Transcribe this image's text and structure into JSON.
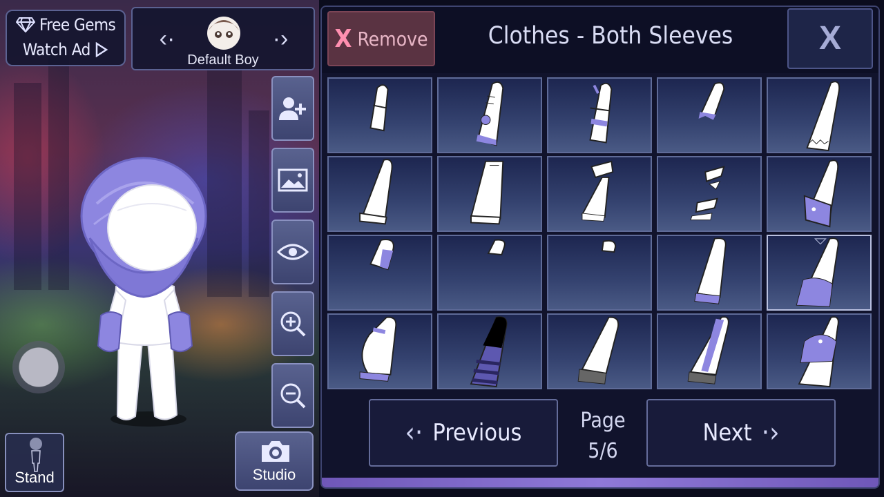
{
  "top_left": {
    "gems_label": "Free Gems",
    "watch_ad_label": "Watch Ad",
    "character_name": "Default Boy"
  },
  "side_buttons": [
    "add-character-icon",
    "background-icon",
    "eye-icon",
    "zoom-in-icon",
    "zoom-out-icon"
  ],
  "stand_label": "Stand",
  "studio_label": "Studio",
  "panel": {
    "remove_label": "Remove",
    "remove_x": "X",
    "title": "Clothes - Both Sleeves",
    "close_label": "X",
    "previous_label": "Previous",
    "next_label": "Next",
    "page_word": "Page",
    "page_number": "5/6"
  },
  "items": [
    {
      "row": 1,
      "col": 1,
      "selected": false
    },
    {
      "row": 1,
      "col": 2,
      "selected": false
    },
    {
      "row": 1,
      "col": 3,
      "selected": false
    },
    {
      "row": 1,
      "col": 4,
      "selected": false
    },
    {
      "row": 1,
      "col": 5,
      "selected": false
    },
    {
      "row": 2,
      "col": 1,
      "selected": false
    },
    {
      "row": 2,
      "col": 2,
      "selected": false
    },
    {
      "row": 2,
      "col": 3,
      "selected": false
    },
    {
      "row": 2,
      "col": 4,
      "selected": false
    },
    {
      "row": 2,
      "col": 5,
      "selected": false
    },
    {
      "row": 3,
      "col": 1,
      "selected": false
    },
    {
      "row": 3,
      "col": 2,
      "selected": false
    },
    {
      "row": 3,
      "col": 3,
      "selected": false
    },
    {
      "row": 3,
      "col": 4,
      "selected": false
    },
    {
      "row": 3,
      "col": 5,
      "selected": true
    },
    {
      "row": 4,
      "col": 1,
      "selected": false
    },
    {
      "row": 4,
      "col": 2,
      "selected": false
    },
    {
      "row": 4,
      "col": 3,
      "selected": false
    },
    {
      "row": 4,
      "col": 4,
      "selected": false
    },
    {
      "row": 4,
      "col": 5,
      "selected": false
    }
  ],
  "colors": {
    "accent_purple": "#8d86e0",
    "panel_bg": "#11132c",
    "remove_bg": "#5a3342"
  }
}
